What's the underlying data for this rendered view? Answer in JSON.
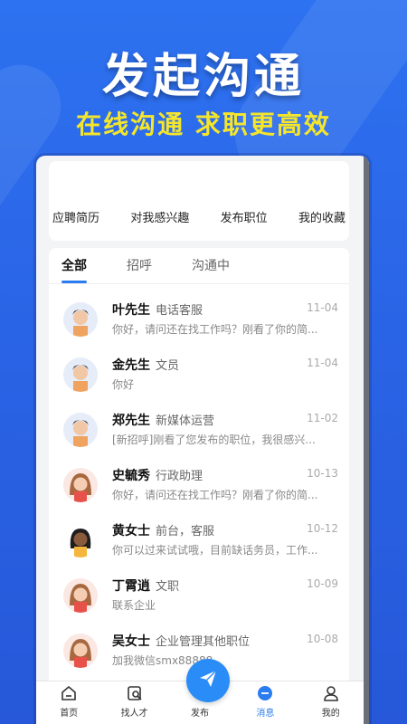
{
  "promo": {
    "headline": "发起沟通",
    "subline": "在线沟通 求职更高效"
  },
  "top_tabs": [
    "应聘简历",
    "对我感兴趣",
    "发布职位",
    "我的收藏"
  ],
  "filter_tabs": [
    "全部",
    "招呼",
    "沟通中"
  ],
  "messages": [
    {
      "name": "叶先生",
      "job": "电话客服",
      "date": "11-04",
      "preview": "你好，请问还在找工作吗？刚看了你的简...",
      "avatar": "male-avatar-icon"
    },
    {
      "name": "金先生",
      "job": "文员",
      "date": "11-04",
      "preview": "你好",
      "avatar": "male-avatar-icon"
    },
    {
      "name": "郑先生",
      "job": "新媒体运营",
      "date": "11-02",
      "preview": "[新招呼]刚看了您发布的职位，我很感兴...",
      "avatar": "male-avatar-icon"
    },
    {
      "name": "史毓秀",
      "job": "行政助理",
      "date": "10-13",
      "preview": "你好，请问还在找工作吗？刚看了你的简...",
      "avatar": "female-avatar-icon"
    },
    {
      "name": "黄女士",
      "job": "前台，客服",
      "date": "10-12",
      "preview": "你可以过来试试哦，目前缺话务员，工作...",
      "avatar": "female-avatar-icon"
    },
    {
      "name": "丁霄逍",
      "job": "文职",
      "date": "10-09",
      "preview": "联系企业",
      "avatar": "female-avatar-icon"
    },
    {
      "name": "吴女士",
      "job": "企业管理其他职位",
      "date": "10-08",
      "preview": "加我微信smx88888",
      "avatar": "female-avatar-icon"
    }
  ],
  "nav": [
    {
      "label": "首页",
      "icon": "home-icon"
    },
    {
      "label": "找人才",
      "icon": "find-talent-icon"
    },
    {
      "label": "发布",
      "icon": "paper-plane-icon"
    },
    {
      "label": "消息",
      "icon": "message-icon"
    },
    {
      "label": "我的",
      "icon": "profile-icon"
    }
  ],
  "colors": {
    "accent": "#2a7cf0",
    "promo_yellow": "#f5e62b",
    "background": "#2a64e6"
  }
}
